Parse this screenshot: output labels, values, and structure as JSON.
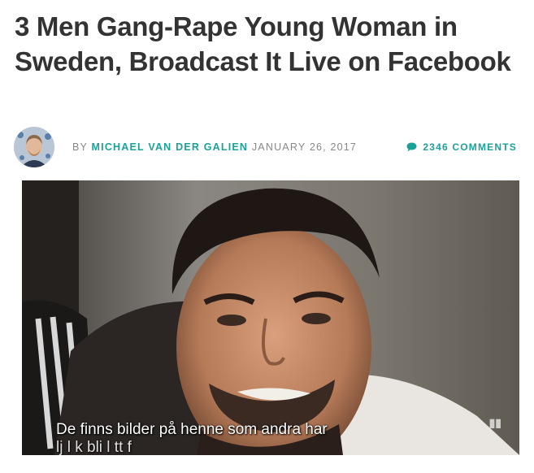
{
  "article": {
    "title": "3 Men Gang-Rape Young Woman in Sweden, Broadcast It Live on Facebook",
    "byline_prefix": "BY",
    "author": "MICHAEL VAN DER GALIEN",
    "date": "JANUARY 26, 2017",
    "comments": "2346 COMMENTS"
  },
  "media": {
    "caption_line1": "De finns bilder på henne som andra har",
    "caption_line2": "lj l             k      bli    l  tt f"
  },
  "colors": {
    "accent": "#1aa29a",
    "title": "#333333",
    "meta": "#888888"
  },
  "icons": {
    "comment": "comment-bubble-icon"
  }
}
